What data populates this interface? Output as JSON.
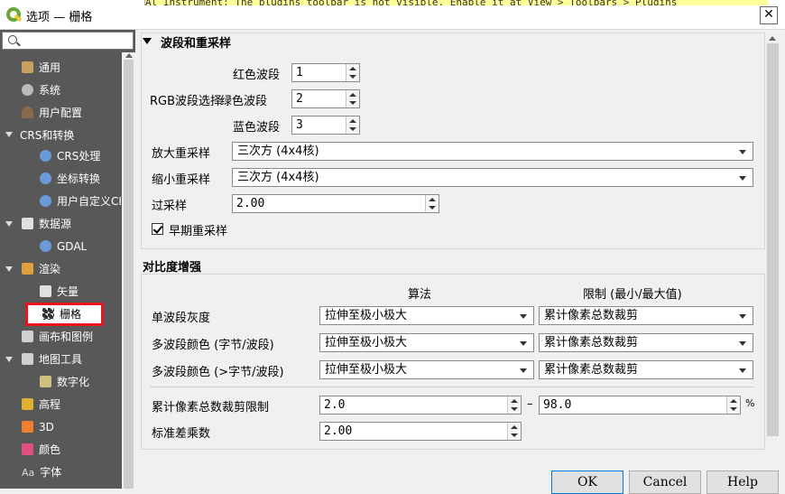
{
  "window": {
    "title": "选项 — 栅格",
    "background_hint_text": "Al Instrument: The plugins toolbar is not visible. Enable it at View > Toolbars > Plugins",
    "close_symbol": "✕"
  },
  "sidebar": {
    "items": [
      {
        "label": "通用",
        "icon": "wrench-icon",
        "color": "#c8a060"
      },
      {
        "label": "系统",
        "icon": "gear-icon",
        "color": "#bbbbbb"
      },
      {
        "label": "用户配置",
        "icon": "user-icon",
        "color": "#8a6a4a"
      },
      {
        "label": "CRS和转换",
        "icon": "caret-down-icon",
        "color": "#dddddd"
      },
      {
        "label": "CRS处理",
        "icon": "globe-icon",
        "color": "#6a9ad8"
      },
      {
        "label": "坐标转换",
        "icon": "globe-transform-icon",
        "color": "#6a9ad8"
      },
      {
        "label": "用户自定义CRS",
        "icon": "globe-user-icon",
        "color": "#6a9ad8"
      },
      {
        "label": "数据源",
        "icon": "table-icon",
        "color": "#e0e0e0"
      },
      {
        "label": "GDAL",
        "icon": "gdal-globe-icon",
        "color": "#6a9ad8"
      },
      {
        "label": "渲染",
        "icon": "paintbrush-icon",
        "color": "#e0a040"
      },
      {
        "label": "矢量",
        "icon": "vector-icon",
        "color": "#e0e0e0"
      },
      {
        "label": "栅格",
        "icon": "raster-icon",
        "color": "#333333"
      },
      {
        "label": "画布和图例",
        "icon": "canvas-icon",
        "color": "#d0d0d0"
      },
      {
        "label": "地图工具",
        "icon": "map-tools-icon",
        "color": "#d0d0d0"
      },
      {
        "label": "数字化",
        "icon": "digitize-icon",
        "color": "#d0c080"
      },
      {
        "label": "高程",
        "icon": "elevation-icon",
        "color": "#e0b030"
      },
      {
        "label": "3D",
        "icon": "3d-icon",
        "color": "#f08030"
      },
      {
        "label": "颜色",
        "icon": "color-icon",
        "color": "#e05080"
      },
      {
        "label": "字体",
        "icon": "font-icon",
        "color": "#dddddd"
      }
    ],
    "font_icon_text": "Aa"
  },
  "bands": {
    "section_title": "波段和重采样",
    "rgb_label": "RGB波段选择",
    "red_label": "红色波段",
    "red_value": "1",
    "green_label": "绿色波段",
    "green_value": "2",
    "blue_label": "蓝色波段",
    "blue_value": "3",
    "zoomin_label": "放大重采样",
    "zoomin_value": "三次方 (4x4核)",
    "zoomout_label": "缩小重采样",
    "zoomout_value": "三次方 (4x4核)",
    "oversample_label": "过采样",
    "oversample_value": "2.00",
    "early_label": "早期重采样"
  },
  "contrast": {
    "section_title": "对比度增强",
    "algorithm_header": "算法",
    "limits_header": "限制 (最小/最大值)",
    "rows": [
      {
        "label": "单波段灰度",
        "algorithm": "拉伸至极小极大",
        "limits": "累计像素总数裁剪"
      },
      {
        "label": "多波段颜色 (字节/波段)",
        "algorithm": "拉伸至极小极大",
        "limits": "累计像素总数裁剪"
      },
      {
        "label": "多波段颜色 (>字节/波段)",
        "algorithm": "拉伸至极小极大",
        "limits": "累计像素总数裁剪"
      }
    ],
    "cumulative_label": "累计像素总数裁剪限制",
    "cumulative_min": "2.0",
    "dash": "–",
    "cumulative_max": "98.0",
    "percent": "%",
    "stddev_label": "标准差乘数",
    "stddev_value": "2.00"
  },
  "buttons": {
    "ok": "OK",
    "cancel": "Cancel",
    "help": "Help"
  }
}
